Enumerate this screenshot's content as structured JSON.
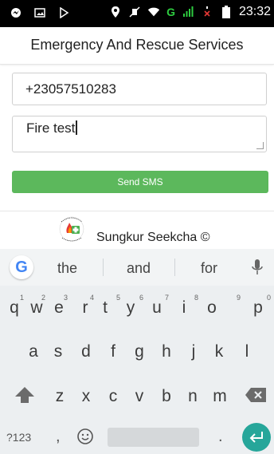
{
  "status_bar": {
    "time": "23:32",
    "network_label": "G",
    "icons": [
      "messenger-icon",
      "image-icon",
      "play-store-icon",
      "location-icon",
      "mute-icon",
      "wifi-icon",
      "signal-icon",
      "no-sim-icon",
      "battery-icon"
    ]
  },
  "app": {
    "title": "Emergency And Rescue Services"
  },
  "form": {
    "phone_value": "+23057510283",
    "message_value": "Fire test",
    "send_label": "Send SMS"
  },
  "footer": {
    "credit": "Sungkur Seekcha ©"
  },
  "keyboard": {
    "suggestions": [
      "the",
      "and",
      "for"
    ],
    "row1": [
      "q",
      "w",
      "e",
      "r",
      "t",
      "y",
      "u",
      "i",
      "o",
      "p"
    ],
    "row1_numbers": [
      "1",
      "2",
      "3",
      "4",
      "5",
      "6",
      "7",
      "8",
      "9",
      "0"
    ],
    "row2": [
      "a",
      "s",
      "d",
      "f",
      "g",
      "h",
      "j",
      "k",
      "l"
    ],
    "row3": [
      "z",
      "x",
      "c",
      "v",
      "b",
      "n",
      "m"
    ],
    "symbols_key": "?123",
    "comma_key": ",",
    "period_key": "."
  },
  "colors": {
    "send_button": "#5cb85c",
    "enter_key": "#26a69a",
    "status_bar": "#000000"
  }
}
